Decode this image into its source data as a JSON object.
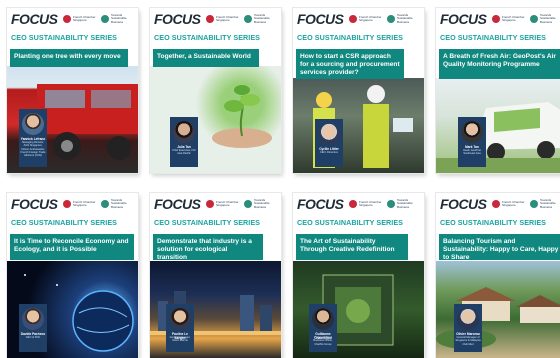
{
  "brand": "FOCUS",
  "partner1": "French Chamber Singapore",
  "partner2": "Towards Sustainable Business",
  "series_label": "CEO SUSTAINABILITY SERIES",
  "colors": {
    "teal": "#11887f",
    "series_text": "#1aa3a0",
    "navy": "#1f3f66"
  },
  "cards": [
    {
      "title": "Planting one tree with every move",
      "name": "Yannick Lefranc",
      "role": "Managing Director, AGS Singapore; Citizen Ambassador, French Foreign Trade Advisors (CCE)",
      "scene": "truck"
    },
    {
      "title": "Together, a Sustainable World",
      "name": "Julia Tan",
      "role": "Chief Executive, ISC Asia Pacific",
      "scene": "plant"
    },
    {
      "title": "How to start a CSR approach for a sourcing and procurement services provider?",
      "name": "Cyrille Littler",
      "role": "CEO, Dimontox",
      "scene": "workers"
    },
    {
      "title": "A Breath of Fresh Air: GeoPost's Air Quality Monitoring Programme",
      "name": "Mark Tan",
      "role": "Head, GeoPost Southeast Asia",
      "scene": "van"
    },
    {
      "title": "It is Time to Reconcile Economy and Ecology, and it is Possible",
      "name": "Davide Pacheco",
      "role": "CEO of FNC",
      "scene": "earth"
    },
    {
      "title": "Demonstrate that industry is a solution for ecological transition",
      "name": "Pauline Le Bargen",
      "role": "General Manager, Solvin Marine",
      "scene": "city"
    },
    {
      "title": "The Art of Sustainability Through Creative Redefinition",
      "name": "Guillaume Chatelilhou",
      "role": "Partner & Chief Business Officer, ChatSG Group",
      "scene": "building"
    },
    {
      "title": "Balancing Tourism and Sustainability: Happy to Care, Happy to Share",
      "name": "Olivier Marceau",
      "role": "General Manager of Singapore & Malaysia Club Med",
      "scene": "resort"
    }
  ]
}
